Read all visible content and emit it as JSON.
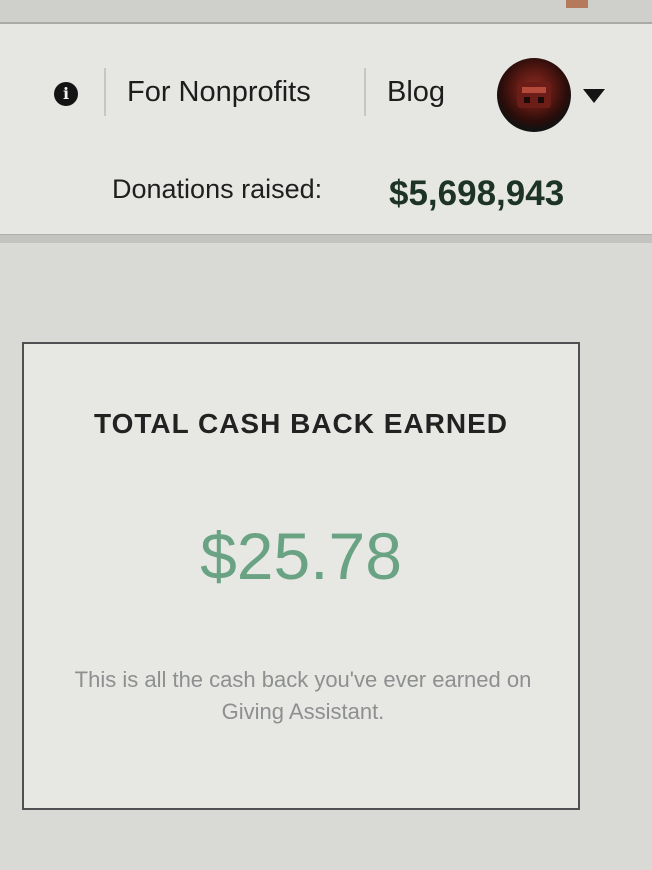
{
  "header": {
    "info_icon": "info-icon",
    "info_glyph": "i",
    "nav": [
      {
        "label": "For Nonprofits"
      },
      {
        "label": "Blog"
      }
    ],
    "avatar_icon": "user-avatar",
    "dropdown_icon": "chevron-down-icon",
    "donations_label": "Donations raised:",
    "donations_value": "$5,698,943"
  },
  "card": {
    "title": "TOTAL CASH BACK EARNED",
    "amount": "$25.78",
    "note": "This is all the cash back you've ever earned on Giving Assistant."
  },
  "colors": {
    "donations_value": "#1d3326",
    "cashback_amount": "#6aa383",
    "note_text": "#8d8f90"
  }
}
